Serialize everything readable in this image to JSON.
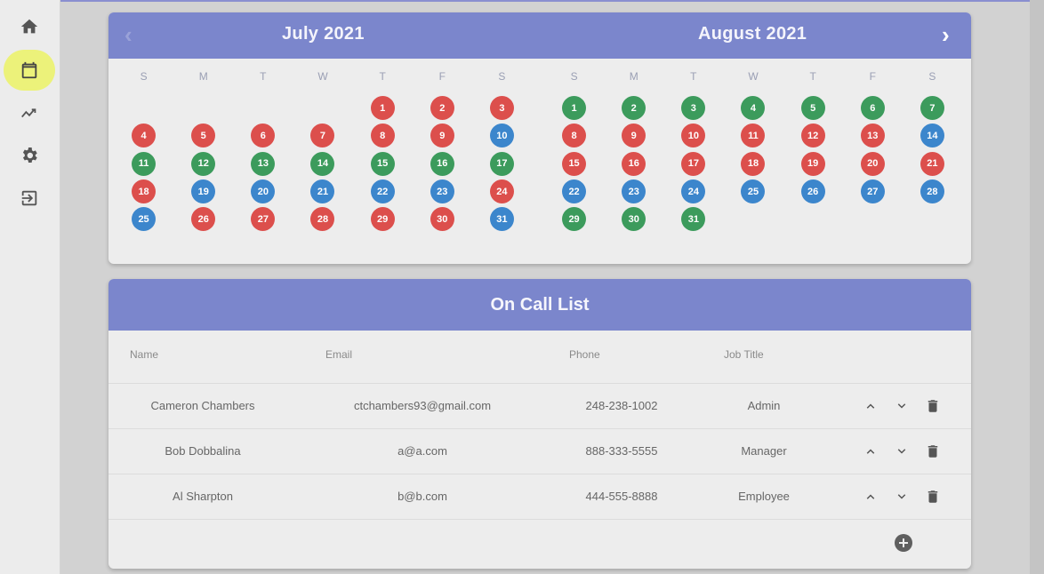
{
  "sidebar": {
    "items": [
      {
        "icon": "home-icon",
        "active": false
      },
      {
        "icon": "calendar-icon",
        "active": true
      },
      {
        "icon": "trending-icon",
        "active": false
      },
      {
        "icon": "gear-icon",
        "active": false
      },
      {
        "icon": "logout-icon",
        "active": false
      }
    ],
    "active_color": "#ecf27a"
  },
  "calendar": {
    "prev_label": "‹",
    "next_label": "›",
    "weekday_labels": [
      "S",
      "M",
      "T",
      "W",
      "T",
      "F",
      "S"
    ],
    "colors": {
      "red": "#dc4f4c",
      "green": "#3c9b5c",
      "blue": "#3c86cc",
      "header": "#7b86cc"
    },
    "months": [
      {
        "title": "July 2021",
        "weeks": [
          [
            null,
            null,
            null,
            null,
            {
              "d": "1",
              "c": "red"
            },
            {
              "d": "2",
              "c": "red"
            },
            {
              "d": "3",
              "c": "red"
            }
          ],
          [
            {
              "d": "4",
              "c": "red"
            },
            {
              "d": "5",
              "c": "red"
            },
            {
              "d": "6",
              "c": "red"
            },
            {
              "d": "7",
              "c": "red"
            },
            {
              "d": "8",
              "c": "red"
            },
            {
              "d": "9",
              "c": "red"
            },
            {
              "d": "10",
              "c": "blue"
            }
          ],
          [
            {
              "d": "11",
              "c": "green"
            },
            {
              "d": "12",
              "c": "green"
            },
            {
              "d": "13",
              "c": "green"
            },
            {
              "d": "14",
              "c": "green"
            },
            {
              "d": "15",
              "c": "green"
            },
            {
              "d": "16",
              "c": "green"
            },
            {
              "d": "17",
              "c": "green"
            }
          ],
          [
            {
              "d": "18",
              "c": "red"
            },
            {
              "d": "19",
              "c": "blue"
            },
            {
              "d": "20",
              "c": "blue"
            },
            {
              "d": "21",
              "c": "blue"
            },
            {
              "d": "22",
              "c": "blue"
            },
            {
              "d": "23",
              "c": "blue"
            },
            {
              "d": "24",
              "c": "red"
            }
          ],
          [
            {
              "d": "25",
              "c": "blue"
            },
            {
              "d": "26",
              "c": "red"
            },
            {
              "d": "27",
              "c": "red"
            },
            {
              "d": "28",
              "c": "red"
            },
            {
              "d": "29",
              "c": "red"
            },
            {
              "d": "30",
              "c": "red"
            },
            {
              "d": "31",
              "c": "blue"
            }
          ]
        ]
      },
      {
        "title": "August 2021",
        "weeks": [
          [
            {
              "d": "1",
              "c": "green"
            },
            {
              "d": "2",
              "c": "green"
            },
            {
              "d": "3",
              "c": "green"
            },
            {
              "d": "4",
              "c": "green"
            },
            {
              "d": "5",
              "c": "green"
            },
            {
              "d": "6",
              "c": "green"
            },
            {
              "d": "7",
              "c": "green"
            }
          ],
          [
            {
              "d": "8",
              "c": "red"
            },
            {
              "d": "9",
              "c": "red"
            },
            {
              "d": "10",
              "c": "red"
            },
            {
              "d": "11",
              "c": "red"
            },
            {
              "d": "12",
              "c": "red"
            },
            {
              "d": "13",
              "c": "red"
            },
            {
              "d": "14",
              "c": "blue"
            }
          ],
          [
            {
              "d": "15",
              "c": "red"
            },
            {
              "d": "16",
              "c": "red"
            },
            {
              "d": "17",
              "c": "red"
            },
            {
              "d": "18",
              "c": "red"
            },
            {
              "d": "19",
              "c": "red"
            },
            {
              "d": "20",
              "c": "red"
            },
            {
              "d": "21",
              "c": "red"
            }
          ],
          [
            {
              "d": "22",
              "c": "blue"
            },
            {
              "d": "23",
              "c": "blue"
            },
            {
              "d": "24",
              "c": "blue"
            },
            {
              "d": "25",
              "c": "blue"
            },
            {
              "d": "26",
              "c": "blue"
            },
            {
              "d": "27",
              "c": "blue"
            },
            {
              "d": "28",
              "c": "blue"
            }
          ],
          [
            {
              "d": "29",
              "c": "green"
            },
            {
              "d": "30",
              "c": "green"
            },
            {
              "d": "31",
              "c": "green"
            },
            null,
            null,
            null,
            null
          ]
        ]
      }
    ]
  },
  "oncall": {
    "title": "On Call List",
    "columns": {
      "name": "Name",
      "email": "Email",
      "phone": "Phone",
      "job_title": "Job Title"
    },
    "rows": [
      {
        "name": "Cameron Chambers",
        "email": "ctchambers93@gmail.com",
        "phone": "248-238-1002",
        "job_title": "Admin"
      },
      {
        "name": "Bob Dobbalina",
        "email": "a@a.com",
        "phone": "888-333-5555",
        "job_title": "Manager"
      },
      {
        "name": "Al Sharpton",
        "email": "b@b.com",
        "phone": "444-555-8888",
        "job_title": "Employee"
      }
    ],
    "row_icons": [
      "chevron-up-icon",
      "chevron-down-icon",
      "trash-icon"
    ],
    "add_icon": "add-circle-icon"
  }
}
